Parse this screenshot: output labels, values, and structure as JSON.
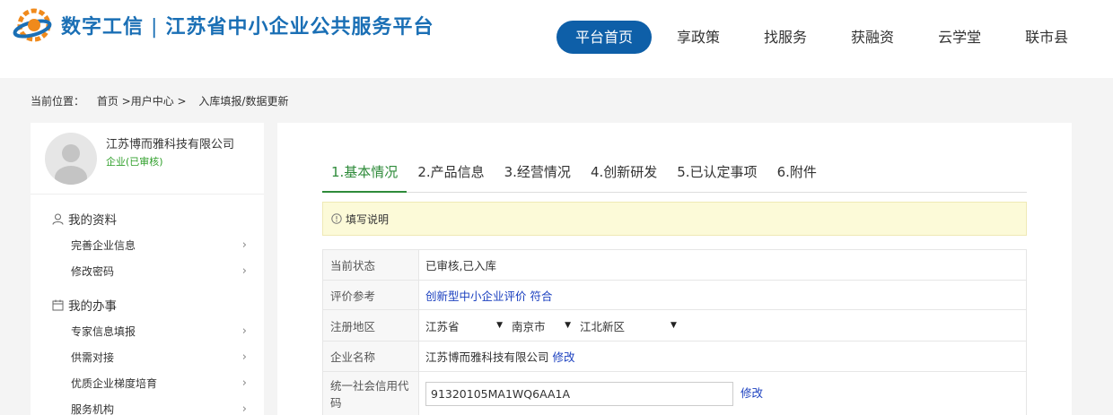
{
  "header": {
    "brand_main": "数字工信",
    "brand_sep": "|",
    "brand_sub": "江苏省中小企业公共服务平台",
    "nav": [
      {
        "label": "平台首页",
        "active": true
      },
      {
        "label": "享政策"
      },
      {
        "label": "找服务"
      },
      {
        "label": "获融资"
      },
      {
        "label": "云学堂"
      },
      {
        "label": "联市县"
      }
    ]
  },
  "breadcrumb": {
    "prefix": "当前位置：",
    "home": "首页 >用户中心 >",
    "current": "入库填报/数据更新"
  },
  "sidebar": {
    "company": "江苏博而雅科技有限公司",
    "status": "企业(已审核)",
    "sections": [
      {
        "title": "我的资料",
        "icon": "user-icon",
        "items": [
          "完善企业信息",
          "修改密码"
        ]
      },
      {
        "title": "我的办事",
        "icon": "calendar-icon",
        "items": [
          "专家信息填报",
          "供需对接",
          "优质企业梯度培育",
          "服务机构"
        ]
      }
    ]
  },
  "main": {
    "tabs": [
      "1.基本情况",
      "2.产品信息",
      "3.经营情况",
      "4.创新研发",
      "5.已认定事项",
      "6.附件"
    ],
    "notice": "填写说明",
    "rows": {
      "status_label": "当前状态",
      "status_value": "已审核,已入库",
      "eval_label": "评价参考",
      "eval_value": "创新型中小企业评价 符合",
      "region_label": "注册地区",
      "province": "江苏省",
      "city": "南京市",
      "district": "江北新区",
      "name_label": "企业名称",
      "name_value": "江苏博而雅科技有限公司",
      "name_edit": "修改",
      "code_label": "统一社会信用代码",
      "code_value": "91320105MA1WQ6AA1A",
      "code_edit": "修改"
    }
  },
  "colors": {
    "primary": "#0e5fa8",
    "tab_active": "#2e8b3a",
    "link": "#1a3fbf",
    "status_green": "#31a02c"
  }
}
